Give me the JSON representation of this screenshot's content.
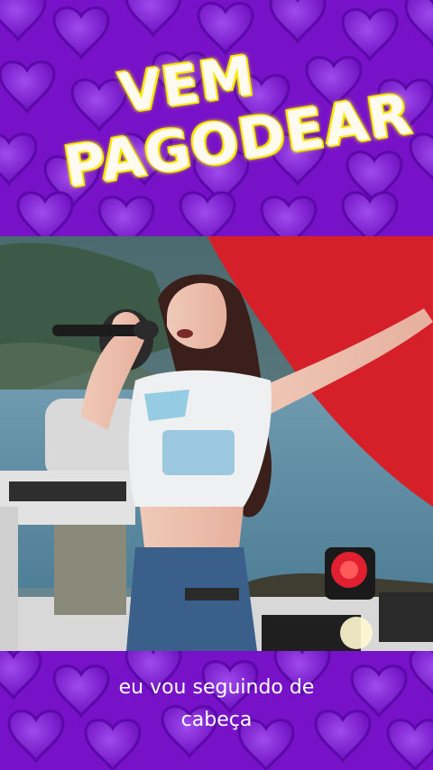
{
  "overlay_title": {
    "line1": "VEM",
    "line2": "PAGODEAR"
  },
  "caption": {
    "line1": "eu vou seguindo de",
    "line2": "cabeça"
  },
  "colors": {
    "background": "#7a10c9",
    "title_glow": "#f6f000",
    "caption_text": "#ffffff"
  },
  "icons": [
    "heart-pattern-icon",
    "stage-light-icon"
  ]
}
